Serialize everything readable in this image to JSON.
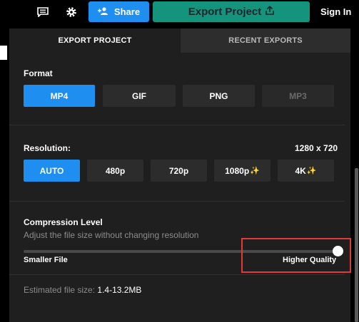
{
  "topbar": {
    "comment_icon": "comment-icon",
    "settings_icon": "gear-icon",
    "share_label": "Share",
    "share_icon": "add-person-icon",
    "export_label": "Export Project",
    "export_icon": "upload-icon",
    "signin_label": "Sign In"
  },
  "tabs": [
    {
      "label": "EXPORT PROJECT",
      "active": true
    },
    {
      "label": "RECENT EXPORTS",
      "active": false
    }
  ],
  "format": {
    "label": "Format",
    "options": [
      {
        "label": "MP4",
        "selected": true
      },
      {
        "label": "GIF",
        "selected": false
      },
      {
        "label": "PNG",
        "selected": false
      },
      {
        "label": "MP3",
        "selected": false,
        "disabled": true
      }
    ]
  },
  "resolution": {
    "label": "Resolution:",
    "value": "1280 x 720",
    "options": [
      {
        "label": "AUTO",
        "selected": true
      },
      {
        "label": "480p",
        "selected": false
      },
      {
        "label": "720p",
        "selected": false
      },
      {
        "label": "1080p",
        "selected": false,
        "premium": true
      },
      {
        "label": "4K",
        "selected": false,
        "premium": true
      }
    ],
    "sparkle": "✨"
  },
  "compression": {
    "label": "Compression Level",
    "description": "Adjust the file size without changing resolution",
    "level": 1.0,
    "min_label": "Smaller File",
    "max_label": "Higher Quality"
  },
  "estimate": {
    "label": "Estimated file size:",
    "value": "1.4-13.2MB"
  },
  "colors": {
    "accent": "#1f8ef1",
    "export": "#14937d",
    "highlight": "#e03a3a"
  }
}
